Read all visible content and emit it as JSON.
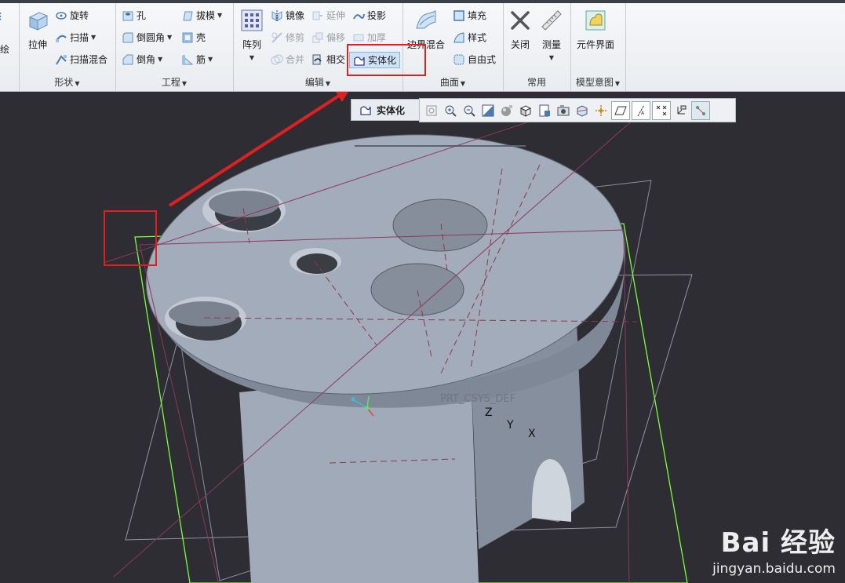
{
  "ribbon": {
    "partial_left_label": "绘",
    "shape": {
      "label": "形状",
      "extrude": "拉伸",
      "revolve": "旋转",
      "sweep": "扫描",
      "swept_blend": "扫描混合"
    },
    "engineering": {
      "label": "工程",
      "hole": "孔",
      "round": "倒圆角",
      "chamfer": "倒角",
      "draft": "拔模",
      "shell": "壳",
      "rib": "筋"
    },
    "editing": {
      "label": "编辑",
      "pattern": "阵列",
      "mirror": "镜像",
      "extend": "延伸",
      "project": "投影",
      "trim": "修剪",
      "offset": "偏移",
      "thicken": "加厚",
      "merge": "合并",
      "intersect": "相交",
      "solidify": "实体化"
    },
    "surfaces": {
      "label": "曲面",
      "boundary_blend": "边界混合",
      "fill": "填充",
      "style": "样式",
      "freestyle": "自由式"
    },
    "common": {
      "label": "常用",
      "close": "关闭",
      "measure": "测量"
    },
    "model_intent": {
      "label": "模型意图",
      "component_interface": "元件界面"
    }
  },
  "tooltip": {
    "text": "实体化"
  },
  "viewport": {
    "part_label": "PRT_CSYS_DEF",
    "axis_z": "Z",
    "axis_y": "Y",
    "axis_x": "X"
  },
  "watermark": {
    "logo": "Bai 经验",
    "url": "jingyan.baidu.com"
  },
  "colors": {
    "highlight": "#e02020",
    "datum_plane": "#7cff3a",
    "model": "#9ea7b6"
  }
}
